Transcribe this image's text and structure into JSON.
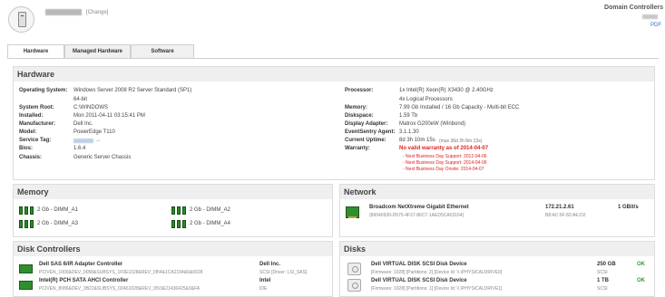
{
  "header": {
    "change_link": "[Change]",
    "domain_title": "Domain Controllers",
    "pdf_link": "PDF"
  },
  "tabs": [
    "Hardware",
    "Managed Hardware",
    "Software"
  ],
  "hardware": {
    "title": "Hardware",
    "left": [
      {
        "label": "Operating System:",
        "value": "Windows Server 2008 R2 Server Standard (SP1)"
      },
      {
        "label": "",
        "value": "64-bit"
      },
      {
        "label": "System Root:",
        "value": "C:\\WINDOWS"
      },
      {
        "label": "Installed:",
        "value": "Mon 2011-04-11 03:15:41 PM"
      },
      {
        "label": "Manufacturer:",
        "value": "Dell Inc."
      },
      {
        "label": "Model:",
        "value": "PowerEdge T110"
      },
      {
        "label": "Service Tag:",
        "value": "→"
      },
      {
        "label": "Bios:",
        "value": "1.6.4"
      },
      {
        "label": "Chassis:",
        "value": "Generic Server Chassis"
      }
    ],
    "right": [
      {
        "label": "Processor:",
        "value": "1x Intel(R) Xeon(R) X3430 @ 2.40GHz"
      },
      {
        "label": "",
        "value": "4x Logical Processors"
      },
      {
        "label": "Memory:",
        "value": "7.99 Gb Installed / 16 Gb Capacity - Multi-bit ECC"
      },
      {
        "label": "Diskspace:",
        "value": "1.59 Tb"
      },
      {
        "label": "Display Adapter:",
        "value": "Matrox G200eW (Winbond)"
      },
      {
        "label": "EventSentry Agent:",
        "value": "3.1.1.30"
      },
      {
        "label": "Current Uptime:",
        "value": "8d 3h 10m 15s",
        "extra": "(max 36d 2h 8m 13s)"
      },
      {
        "label": "Warranty:",
        "value": "No valid warranty as of 2014-04-07"
      }
    ],
    "warranty_lines": [
      "- Next Business Day Support: 2012-04-06",
      "- Next Business Day Support: 2014-04-06",
      "- Next Business Day Onsite: 2014-04-07"
    ]
  },
  "memory": {
    "title": "Memory",
    "modules": [
      {
        "label": "2 Gb - DIMM_A1"
      },
      {
        "label": "2 Gb - DIMM_A2"
      },
      {
        "label": "2 Gb - DIMM_A3"
      },
      {
        "label": "2 Gb - DIMM_A4"
      }
    ]
  },
  "network": {
    "title": "Network",
    "adapters": [
      {
        "name": "Broadcom NetXtreme Gigabit Ethernet",
        "id": "{86040930-D575-4F37-86C7-1AED5CA03164}",
        "ip": "172.21.2.61",
        "mac": "B8:AC:6F:82:AE:D2",
        "speed": "1 GBit/s"
      }
    ]
  },
  "disk_controllers": {
    "title": "Disk Controllers",
    "items": [
      {
        "name": "Dell SAS 6/iR Adapter Controller",
        "id": "PCIVEN_1000&DEV_0058&SUBSYS_1F0E1028&REV_08\\4&1CA2194&0&0028",
        "vendor": "Dell Inc.",
        "driver": "SCSI [Driver: LSI_SAS]"
      },
      {
        "name": "Intel(R) PCH SATA AHCI Controller",
        "id": "PCIVEN_8086&DEV_3B22&SUBSYS_02A61028&REV_05\\3&21436425&0&FA",
        "vendor": "Intel",
        "driver": "IDE"
      }
    ]
  },
  "disks": {
    "title": "Disks",
    "items": [
      {
        "name": "Dell VIRTUAL DISK SCSI Disk Device",
        "info": "[Firmware: 1028] [Partitions: 2] [Device Id: \\\\.\\PHYSICALDRIVE0]",
        "size": "250 GB",
        "type": "SCSI",
        "status": "OK"
      },
      {
        "name": "Dell VIRTUAL DISK SCSI Disk Device",
        "info": "[Firmware: 1028] [Partitions: 1] [Device Id: \\\\.\\PHYSICALDRIVE1]",
        "size": "1 TB",
        "type": "SCSI",
        "status": "OK"
      }
    ]
  }
}
